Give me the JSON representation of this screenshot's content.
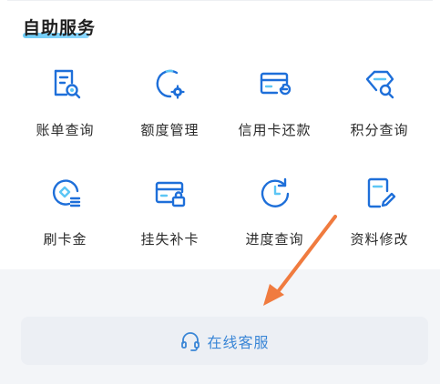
{
  "section": {
    "title": "自助服务"
  },
  "services": [
    {
      "label": "账单查询",
      "icon": "bill-search-icon"
    },
    {
      "label": "额度管理",
      "icon": "quota-gear-icon"
    },
    {
      "label": "信用卡还款",
      "icon": "card-repay-icon"
    },
    {
      "label": "积分查询",
      "icon": "points-tag-search-icon"
    },
    {
      "label": "刷卡金",
      "icon": "card-gold-icon"
    },
    {
      "label": "挂失补卡",
      "icon": "card-lock-icon"
    },
    {
      "label": "进度查询",
      "icon": "progress-refresh-icon"
    },
    {
      "label": "资料修改",
      "icon": "doc-edit-icon"
    }
  ],
  "customer_service": {
    "label": "在线客服",
    "icon": "headset-icon"
  },
  "colors": {
    "icon_blue": "#1e6fd9",
    "accent_light": "#5cc6f5",
    "button_text": "#3a86d6",
    "arrow": "#f07b3f"
  }
}
